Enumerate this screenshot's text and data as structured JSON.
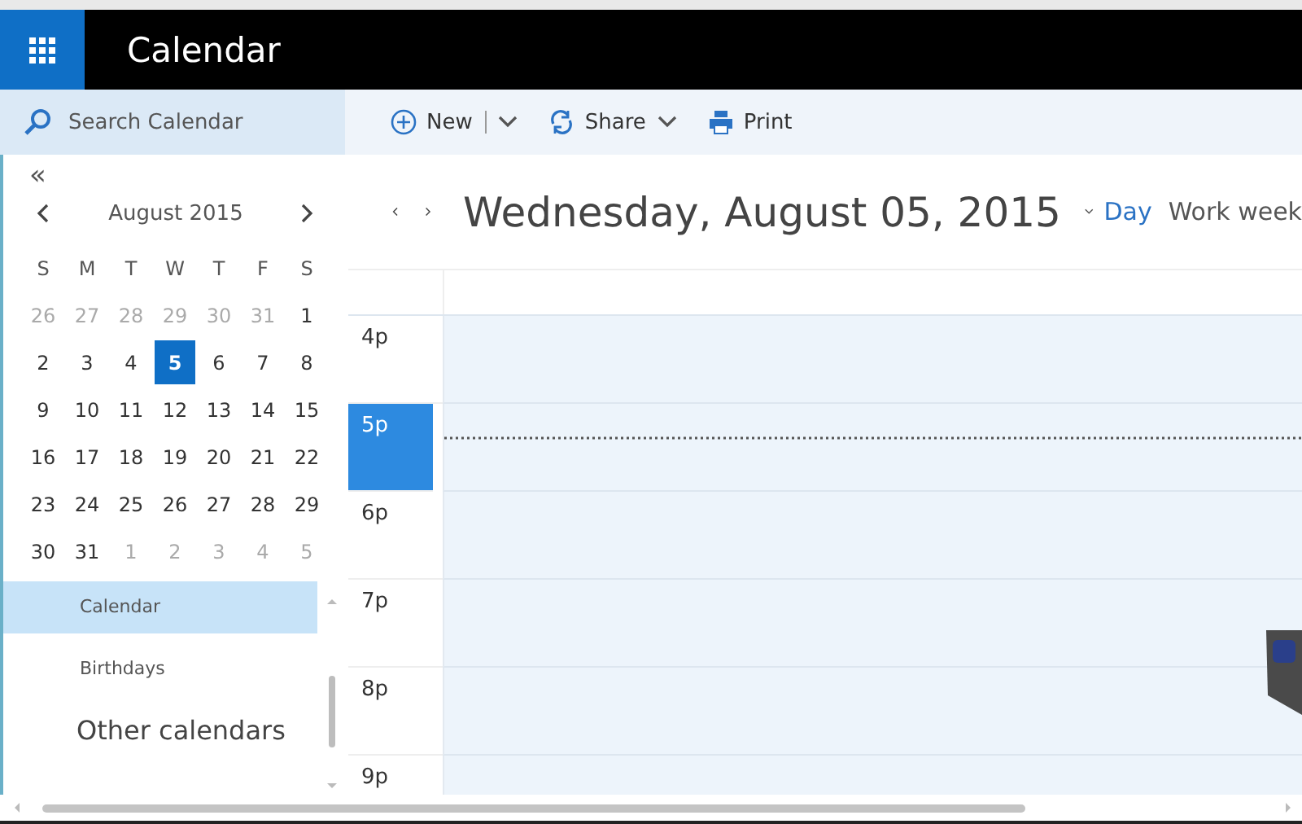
{
  "app": {
    "title": "Calendar"
  },
  "search": {
    "placeholder": "Search Calendar"
  },
  "toolbar": [
    {
      "kind": "new",
      "label": "New"
    },
    {
      "kind": "share",
      "label": "Share"
    },
    {
      "kind": "print",
      "label": "Print"
    }
  ],
  "mini_calendar": {
    "collapse": "«",
    "month": "August 2015",
    "weekdays": [
      "S",
      "M",
      "T",
      "W",
      "T",
      "F",
      "S"
    ],
    "weeks": [
      [
        {
          "day": "26",
          "muted": true,
          "selected": false
        },
        {
          "day": "27",
          "muted": true,
          "selected": false
        },
        {
          "day": "28",
          "muted": true,
          "selected": false
        },
        {
          "day": "29",
          "muted": true,
          "selected": false
        },
        {
          "day": "30",
          "muted": true,
          "selected": false
        },
        {
          "day": "31",
          "muted": true,
          "selected": false
        },
        {
          "day": "1",
          "muted": false,
          "selected": false
        }
      ],
      [
        {
          "day": "2",
          "muted": false,
          "selected": false
        },
        {
          "day": "3",
          "muted": false,
          "selected": false
        },
        {
          "day": "4",
          "muted": false,
          "selected": false
        },
        {
          "day": "5",
          "muted": false,
          "selected": true
        },
        {
          "day": "6",
          "muted": false,
          "selected": false
        },
        {
          "day": "7",
          "muted": false,
          "selected": false
        },
        {
          "day": "8",
          "muted": false,
          "selected": false
        }
      ],
      [
        {
          "day": "9",
          "muted": false,
          "selected": false
        },
        {
          "day": "10",
          "muted": false,
          "selected": false
        },
        {
          "day": "11",
          "muted": false,
          "selected": false
        },
        {
          "day": "12",
          "muted": false,
          "selected": false
        },
        {
          "day": "13",
          "muted": false,
          "selected": false
        },
        {
          "day": "14",
          "muted": false,
          "selected": false
        },
        {
          "day": "15",
          "muted": false,
          "selected": false
        }
      ],
      [
        {
          "day": "16",
          "muted": false,
          "selected": false
        },
        {
          "day": "17",
          "muted": false,
          "selected": false
        },
        {
          "day": "18",
          "muted": false,
          "selected": false
        },
        {
          "day": "19",
          "muted": false,
          "selected": false
        },
        {
          "day": "20",
          "muted": false,
          "selected": false
        },
        {
          "day": "21",
          "muted": false,
          "selected": false
        },
        {
          "day": "22",
          "muted": false,
          "selected": false
        }
      ],
      [
        {
          "day": "23",
          "muted": false,
          "selected": false
        },
        {
          "day": "24",
          "muted": false,
          "selected": false
        },
        {
          "day": "25",
          "muted": false,
          "selected": false
        },
        {
          "day": "26",
          "muted": false,
          "selected": false
        },
        {
          "day": "27",
          "muted": false,
          "selected": false
        },
        {
          "day": "28",
          "muted": false,
          "selected": false
        },
        {
          "day": "29",
          "muted": false,
          "selected": false
        }
      ],
      [
        {
          "day": "30",
          "muted": false,
          "selected": false
        },
        {
          "day": "31",
          "muted": false,
          "selected": false
        },
        {
          "day": "1",
          "muted": true,
          "selected": false
        },
        {
          "day": "2",
          "muted": true,
          "selected": false
        },
        {
          "day": "3",
          "muted": true,
          "selected": false
        },
        {
          "day": "4",
          "muted": true,
          "selected": false
        },
        {
          "day": "5",
          "muted": true,
          "selected": false
        }
      ]
    ]
  },
  "calendars": [
    {
      "label": "Calendar",
      "selected": true
    },
    {
      "label": "Birthdays",
      "selected": false
    }
  ],
  "other_calendars": "Other calendars",
  "day_view": {
    "date": "Wednesday, August 05, 2015",
    "views": [
      {
        "label": "Day",
        "selected": true
      },
      {
        "label": "Work week",
        "selected": false
      }
    ],
    "hours": [
      {
        "label": "4p",
        "current": false
      },
      {
        "label": "5p",
        "current": true
      },
      {
        "label": "6p",
        "current": false
      },
      {
        "label": "7p",
        "current": false
      },
      {
        "label": "8p",
        "current": false
      },
      {
        "label": "9p",
        "current": false
      }
    ]
  }
}
